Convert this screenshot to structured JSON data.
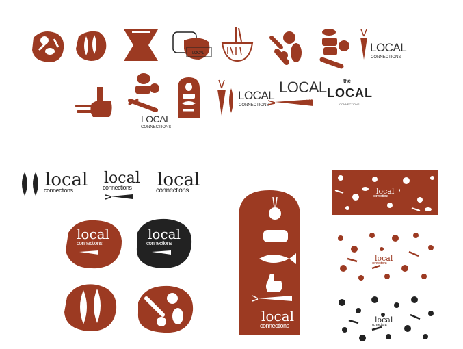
{
  "brand": {
    "word_local": "local",
    "word_local_caps": "LOCAL",
    "word_connections": "connections",
    "word_connections_caps": "CONNECTIONS",
    "word_the": "the",
    "tagline_small": "CONNECTIONS"
  },
  "colors": {
    "brand": "#9c3a22",
    "dark": "#222222",
    "white": "#ffffff"
  },
  "icons": [
    "fish-icon",
    "carrot-icon",
    "radish-icon",
    "bread-icon",
    "hand-icon",
    "bowl-icon",
    "apple-icon"
  ]
}
